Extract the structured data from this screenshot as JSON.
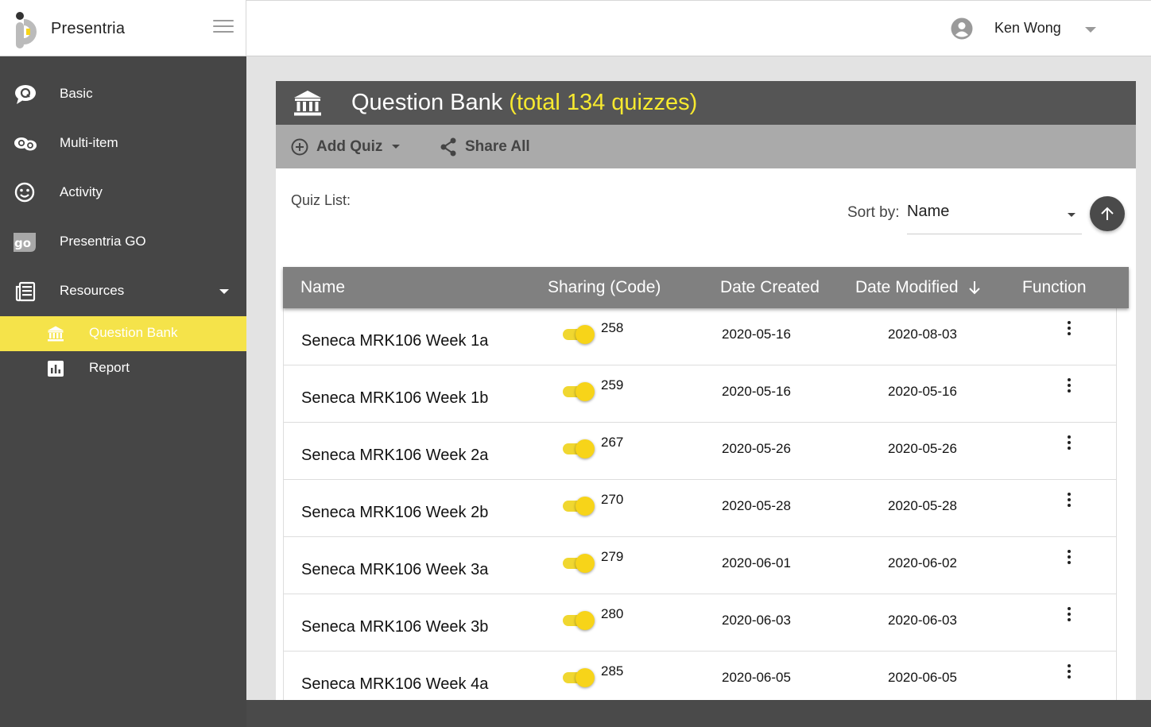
{
  "brand": {
    "name": "Presentria"
  },
  "user": {
    "name": "Ken Wong"
  },
  "sidebar": {
    "items": [
      {
        "label": "Basic",
        "icon": "chat-bubble-q-icon"
      },
      {
        "label": "Multi-item",
        "icon": "chat-bubbles-q-icon"
      },
      {
        "label": "Activity",
        "icon": "smiley-icon"
      },
      {
        "label": "Presentria GO",
        "icon": "go-icon"
      },
      {
        "label": "Resources",
        "icon": "newspaper-icon"
      }
    ],
    "sub_items": [
      {
        "label": "Question Bank",
        "icon": "bank-icon",
        "active": true
      },
      {
        "label": "Report",
        "icon": "bar-chart-icon",
        "active": false
      }
    ]
  },
  "card": {
    "title": "Question Bank",
    "title_highlight": "(total 134 quizzes)",
    "add_quiz_label": "Add Quiz",
    "share_all_label": "Share All"
  },
  "quiz_list_label": "Quiz List:",
  "sort": {
    "label": "Sort by:",
    "value": "Name"
  },
  "table": {
    "headers": {
      "name": "Name",
      "sharing": "Sharing (Code)",
      "created": "Date Created",
      "modified": "Date Modified",
      "function": "Function"
    },
    "rows": [
      {
        "name": "Seneca MRK106 Week 1a",
        "code": "258",
        "shared": true,
        "created": "2020-05-16",
        "modified": "2020-08-03"
      },
      {
        "name": "Seneca MRK106 Week 1b",
        "code": "259",
        "shared": true,
        "created": "2020-05-16",
        "modified": "2020-05-16"
      },
      {
        "name": "Seneca MRK106 Week 2a",
        "code": "267",
        "shared": true,
        "created": "2020-05-26",
        "modified": "2020-05-26"
      },
      {
        "name": "Seneca MRK106 Week 2b",
        "code": "270",
        "shared": true,
        "created": "2020-05-28",
        "modified": "2020-05-28"
      },
      {
        "name": "Seneca MRK106 Week 3a",
        "code": "279",
        "shared": true,
        "created": "2020-06-01",
        "modified": "2020-06-02"
      },
      {
        "name": "Seneca MRK106 Week 3b",
        "code": "280",
        "shared": true,
        "created": "2020-06-03",
        "modified": "2020-06-03"
      },
      {
        "name": "Seneca MRK106 Week 4a",
        "code": "285",
        "shared": true,
        "created": "2020-06-05",
        "modified": "2020-06-05"
      }
    ]
  },
  "colors": {
    "accent_yellow": "#f5e34a",
    "sidebar_bg": "#464646",
    "header_bg": "#555555",
    "table_header_bg": "#808080"
  }
}
